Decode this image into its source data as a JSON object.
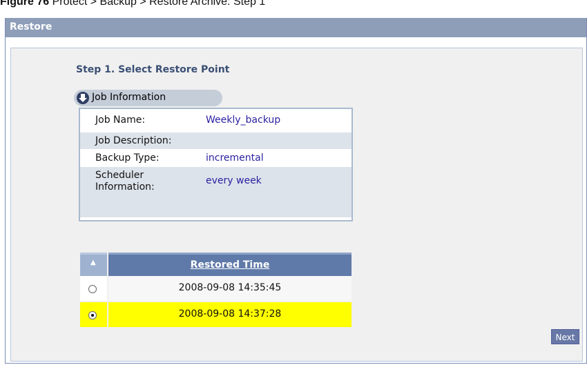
{
  "caption": {
    "label": "Figure 76",
    "text": "Protect > Backup > Restore Archive: Step 1"
  },
  "window": {
    "title": "Restore"
  },
  "step": {
    "title": "Step 1. Select Restore Point"
  },
  "job_section": {
    "label": "Job Information",
    "icon": "expand-down-icon"
  },
  "job_info": [
    {
      "key": "Job Name:",
      "value": "Weekly_backup"
    },
    {
      "key": "Job Description:",
      "value": ""
    },
    {
      "key": "Backup Type:",
      "value": "incremental"
    },
    {
      "key": "Scheduler Information:",
      "value": "every week"
    }
  ],
  "restore_table": {
    "sort_glyph": "▲",
    "header": "Restored Time",
    "rows": [
      {
        "time": "2008-09-08 14:35:45",
        "selected": false
      },
      {
        "time": "2008-09-08 14:37:28",
        "selected": true
      }
    ]
  },
  "buttons": {
    "next_label": "Next"
  },
  "colors": {
    "titlebar": "#8e9db8",
    "selected_row": "#ffff00",
    "header": "#5f79a8"
  }
}
